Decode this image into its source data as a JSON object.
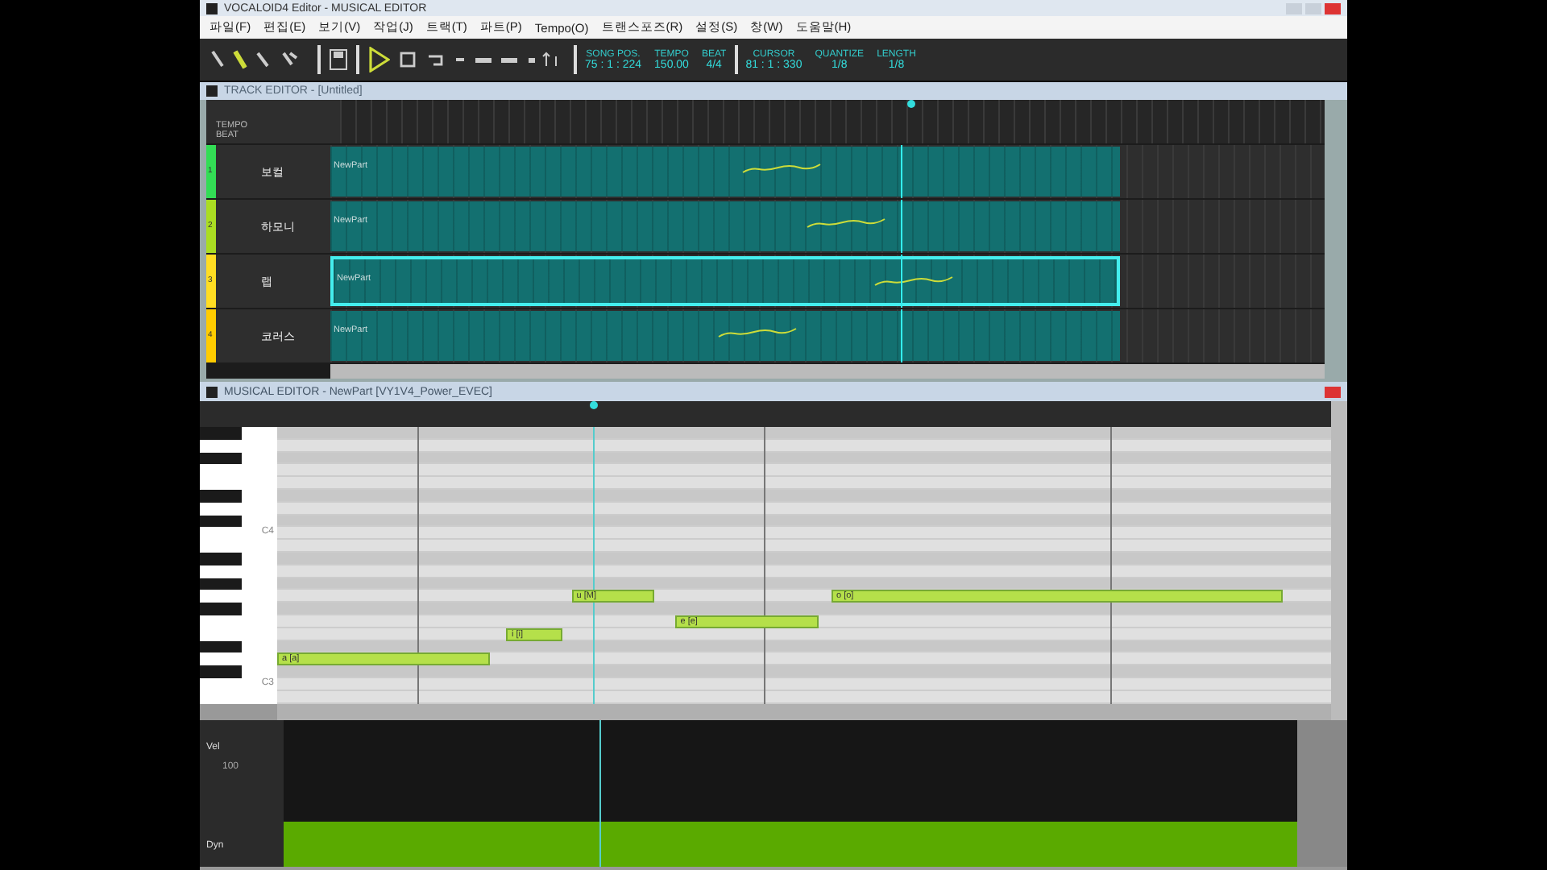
{
  "window": {
    "title": "VOCALOID4 Editor - MUSICAL EDITOR"
  },
  "menu": [
    "파일(F)",
    "편집(E)",
    "보기(V)",
    "작업(J)",
    "트랙(T)",
    "파트(P)",
    "Tempo(O)",
    "트랜스포즈(R)",
    "설정(S)",
    "창(W)",
    "도움말(H)"
  ],
  "readouts": [
    {
      "label": "SONG POS.",
      "value": "75 : 1 : 224"
    },
    {
      "label": "TEMPO",
      "value": "150.00"
    },
    {
      "label": "BEAT",
      "value": "4/4"
    },
    {
      "label": "CURSOR",
      "value": "81 : 1 : 330"
    },
    {
      "label": "QUANTIZE",
      "value": "1/8"
    },
    {
      "label": "LENGTH",
      "value": "1/8"
    }
  ],
  "track_editor": {
    "title": "TRACK EDITOR - [Untitled]",
    "ruler_labels": [
      "TEMPO",
      "BEAT"
    ],
    "tracks": [
      {
        "number": "1",
        "name": "보컬",
        "part": "NewPart",
        "color": "#33dd55",
        "selected": false
      },
      {
        "number": "2",
        "name": "하모니",
        "part": "NewPart",
        "color": "#aadd22",
        "selected": false
      },
      {
        "number": "3",
        "name": "랩",
        "part": "NewPart",
        "color": "#ffdd22",
        "selected": true
      },
      {
        "number": "4",
        "name": "코러스",
        "part": "NewPart",
        "color": "#ffcc00",
        "selected": false
      }
    ]
  },
  "musical_editor": {
    "title": "MUSICAL EDITOR - NewPart [VY1V4_Power_EVEC]",
    "octave_labels": [
      "C4",
      "C3"
    ],
    "notes": [
      {
        "lyric": "a [a]"
      },
      {
        "lyric": "i [i]"
      },
      {
        "lyric": "u [M]"
      },
      {
        "lyric": "e [e]"
      },
      {
        "lyric": "o [o]"
      }
    ],
    "control_track": {
      "label": "Vel",
      "value": "100",
      "lower_label": "Dyn"
    }
  }
}
